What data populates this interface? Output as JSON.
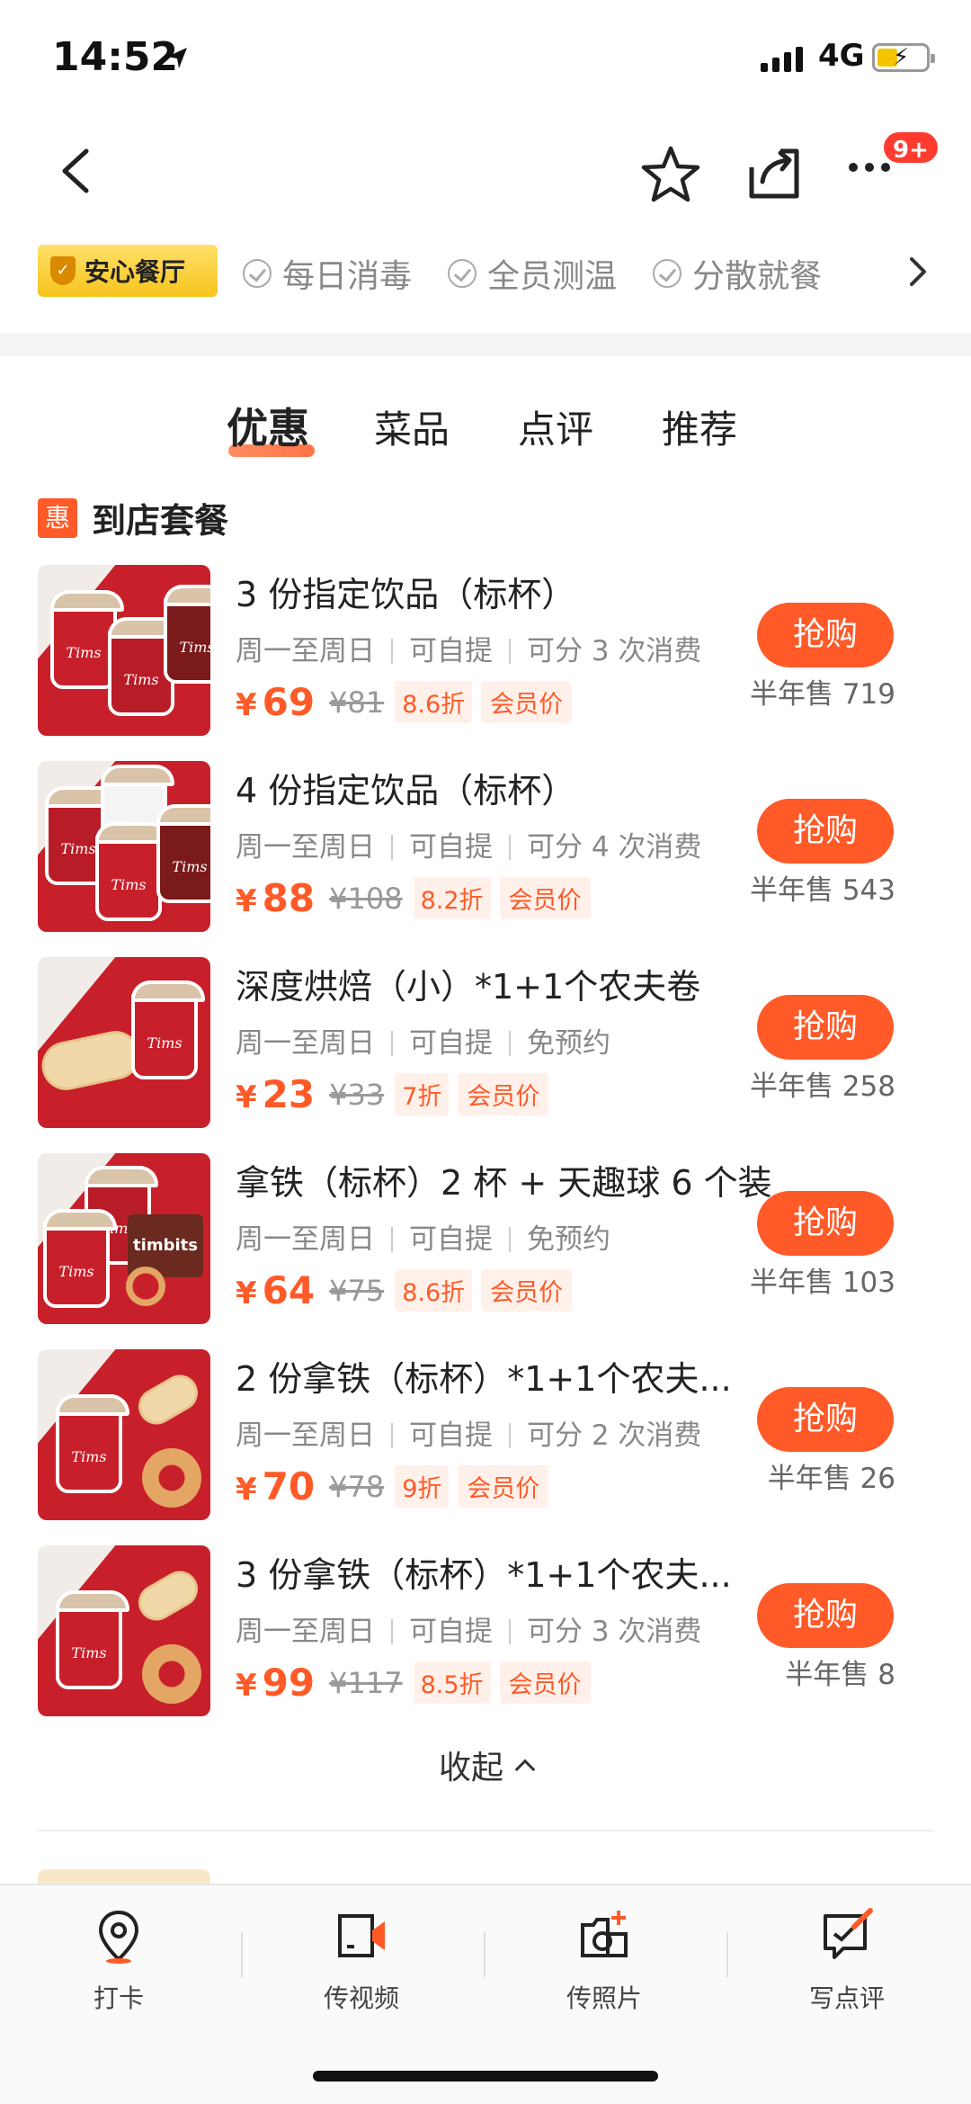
{
  "status": {
    "time": "14:52",
    "network": "4G"
  },
  "nav": {
    "badge": "9+"
  },
  "tags": {
    "safe_label": "安心餐厅",
    "items": [
      "每日消毒",
      "全员测温",
      "分散就餐"
    ]
  },
  "tabs": [
    "优惠",
    "菜品",
    "点评",
    "推荐"
  ],
  "section": {
    "icon_text": "惠",
    "title": "到店套餐"
  },
  "deals": [
    {
      "name": "3 份指定饮品（标杯）",
      "sub": [
        "周一至周日",
        "可自提",
        "可分 3 次消费"
      ],
      "price": "69",
      "orig": "81",
      "discount": "8.6折",
      "member": "会员价",
      "buy": "抢购",
      "sold": "半年售 719"
    },
    {
      "name": "4 份指定饮品（标杯）",
      "sub": [
        "周一至周日",
        "可自提",
        "可分 4 次消费"
      ],
      "price": "88",
      "orig": "108",
      "discount": "8.2折",
      "member": "会员价",
      "buy": "抢购",
      "sold": "半年售 543"
    },
    {
      "name": "深度烘焙（小）*1+1个农夫卷",
      "sub": [
        "周一至周日",
        "可自提",
        "免预约"
      ],
      "price": "23",
      "orig": "33",
      "discount": "7折",
      "member": "会员价",
      "buy": "抢购",
      "sold": "半年售 258"
    },
    {
      "name": "拿铁（标杯）2 杯 + 天趣球 6 个装",
      "sub": [
        "周一至周日",
        "可自提",
        "免预约"
      ],
      "price": "64",
      "orig": "75",
      "discount": "8.6折",
      "member": "会员价",
      "buy": "抢购",
      "sold": "半年售 103"
    },
    {
      "name": "2 份拿铁（标杯）*1+1个农夫...",
      "sub": [
        "周一至周日",
        "可自提",
        "可分 2 次消费"
      ],
      "price": "70",
      "orig": "78",
      "discount": "9折",
      "member": "会员价",
      "buy": "抢购",
      "sold": "半年售 26"
    },
    {
      "name": "3 份拿铁（标杯）*1+1个农夫...",
      "sub": [
        "周一至周日",
        "可自提",
        "可分 3 次消费"
      ],
      "price": "99",
      "orig": "117",
      "discount": "8.5折",
      "member": "会员价",
      "buy": "抢购",
      "sold": "半年售 8"
    }
  ],
  "currency": "¥",
  "collapse_label": "收起",
  "bottom_bar": [
    {
      "label": "打卡",
      "icon": "location-pin-icon"
    },
    {
      "label": "传视频",
      "icon": "video-upload-icon"
    },
    {
      "label": "传照片",
      "icon": "photo-upload-icon"
    },
    {
      "label": "写点评",
      "icon": "write-review-icon"
    }
  ],
  "colors": {
    "accent": "#ff5a28",
    "gold": "#f6c41c",
    "brand_red": "#c8202b"
  }
}
